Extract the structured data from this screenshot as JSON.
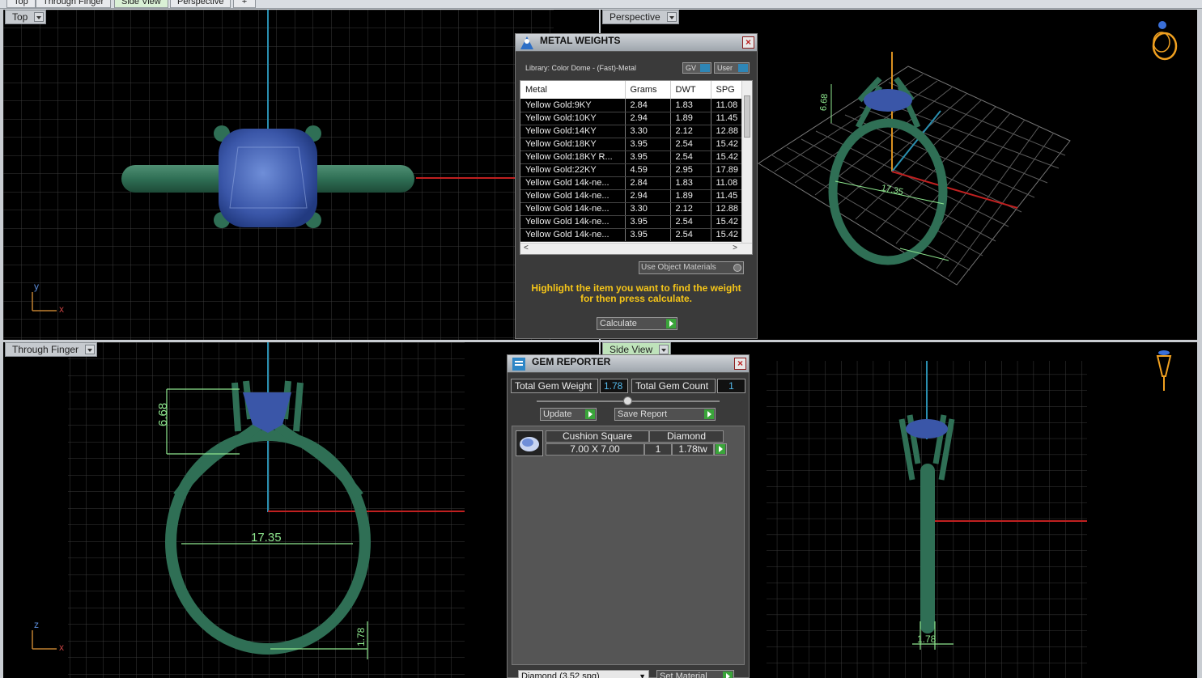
{
  "tabs": [
    {
      "label": "Top",
      "active": false
    },
    {
      "label": "Through Finger",
      "active": false
    },
    {
      "label": "Side View",
      "active": true
    },
    {
      "label": "Perspective",
      "active": false
    },
    {
      "label": "+",
      "active": false
    }
  ],
  "viewports": {
    "top_left": {
      "label": "Top",
      "axis_labels": [
        "y",
        "x"
      ]
    },
    "top_right": {
      "label": "Perspective",
      "dims": [
        "6.68",
        "17.35"
      ]
    },
    "bottom_left": {
      "label": "Through Finger",
      "axis_labels": [
        "z",
        "x"
      ],
      "dims": [
        "6.68",
        "17.35",
        "1.78"
      ]
    },
    "bottom_right": {
      "label": "Side View",
      "dims": [
        "1.78"
      ]
    }
  },
  "metal_weights": {
    "title": "METAL WEIGHTS",
    "library": "Library: Color Dome - (Fast)-Metal",
    "toggles": [
      "GV",
      "User"
    ],
    "columns": [
      "Metal",
      "Grams",
      "DWT",
      "SPG"
    ],
    "rows": [
      [
        "Yellow Gold:9KY",
        "2.84",
        "1.83",
        "11.08"
      ],
      [
        "Yellow Gold:10KY",
        "2.94",
        "1.89",
        "11.45"
      ],
      [
        "Yellow Gold:14KY",
        "3.30",
        "2.12",
        "12.88"
      ],
      [
        "Yellow Gold:18KY",
        "3.95",
        "2.54",
        "15.42"
      ],
      [
        "Yellow Gold:18KY R...",
        "3.95",
        "2.54",
        "15.42"
      ],
      [
        "Yellow Gold:22KY",
        "4.59",
        "2.95",
        "17.89"
      ],
      [
        "Yellow Gold 14k-ne...",
        "2.84",
        "1.83",
        "11.08"
      ],
      [
        "Yellow Gold 14k-ne...",
        "2.94",
        "1.89",
        "11.45"
      ],
      [
        "Yellow Gold 14k-ne...",
        "3.30",
        "2.12",
        "12.88"
      ],
      [
        "Yellow Gold 14k-ne...",
        "3.95",
        "2.54",
        "15.42"
      ],
      [
        "Yellow Gold 14k-ne...",
        "3.95",
        "2.54",
        "15.42"
      ]
    ],
    "use_object_materials": "Use Object Materials",
    "hint": "Highlight the item you want to find the weight for then press calculate.",
    "calculate": "Calculate"
  },
  "gem_reporter": {
    "title": "GEM REPORTER",
    "total_weight_label": "Total Gem Weight",
    "total_weight_value": "1.78",
    "total_count_label": "Total Gem Count",
    "total_count_value": "1",
    "update": "Update",
    "save_report": "Save Report",
    "gem": {
      "shape": "Cushion Square",
      "size": "7.00 X 7.00",
      "material": "Diamond",
      "count": "1",
      "weight": "1.78tw"
    },
    "material_select": "Diamond    (3.52 spg)",
    "set_material": "Set Material"
  },
  "colors": {
    "metal": "#2f6f55",
    "gem": "#3a56a8",
    "dimension": "#8fe88f",
    "axis_red": "#c02020",
    "axis_blue": "#2a8fb0"
  }
}
